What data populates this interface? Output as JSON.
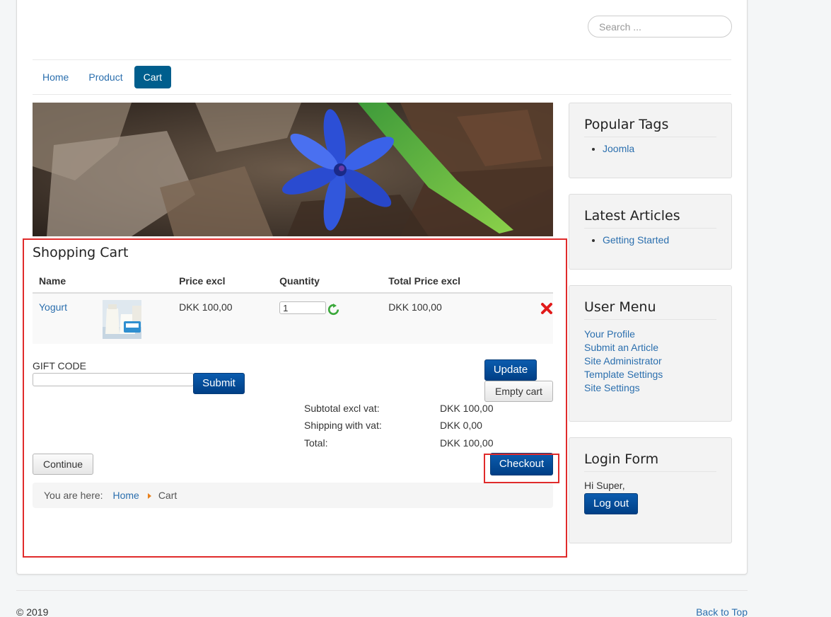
{
  "search": {
    "placeholder": "Search ..."
  },
  "nav": {
    "items": [
      "Home",
      "Product",
      "Cart"
    ],
    "active": "Cart"
  },
  "cart": {
    "title": "Shopping Cart",
    "columns": [
      "Name",
      "Price excl",
      "Quantity",
      "Total Price excl"
    ],
    "items": [
      {
        "name": "Yogurt",
        "price": "DKK 100,00",
        "quantity": "1",
        "total": "DKK 100,00"
      }
    ],
    "gift_code_label": "GIFT CODE",
    "submit_label": "Submit",
    "update_label": "Update",
    "empty_label": "Empty cart",
    "summary": [
      {
        "label": "Subtotal excl vat:",
        "value": "DKK 100,00"
      },
      {
        "label": "Shipping with vat:",
        "value": "DKK 0,00"
      },
      {
        "label": "Total:",
        "value": "DKK 100,00"
      }
    ],
    "continue_label": "Continue",
    "checkout_label": "Checkout"
  },
  "breadcrumb": {
    "prefix": "You are here:",
    "home": "Home",
    "current": "Cart"
  },
  "sidebar": {
    "popular_tags": {
      "title": "Popular Tags",
      "items": [
        "Joomla"
      ]
    },
    "latest_articles": {
      "title": "Latest Articles",
      "items": [
        "Getting Started"
      ]
    },
    "user_menu": {
      "title": "User Menu",
      "items": [
        "Your Profile",
        "Submit an Article",
        "Site Administrator",
        "Template Settings",
        "Site Settings"
      ]
    },
    "login_form": {
      "title": "Login Form",
      "greeting": "Hi Super,",
      "logout_label": "Log out"
    }
  },
  "footer": {
    "copyright": "© 2019",
    "back_to_top": "Back to Top"
  },
  "colors": {
    "accent": "#005e8d",
    "button": "#003f86",
    "highlight": "#e02b2b",
    "link": "#2b6fae"
  },
  "icons": {
    "refresh": "refresh-icon",
    "remove": "remove-icon",
    "breadcrumb_separator": "triangle-right-icon"
  }
}
